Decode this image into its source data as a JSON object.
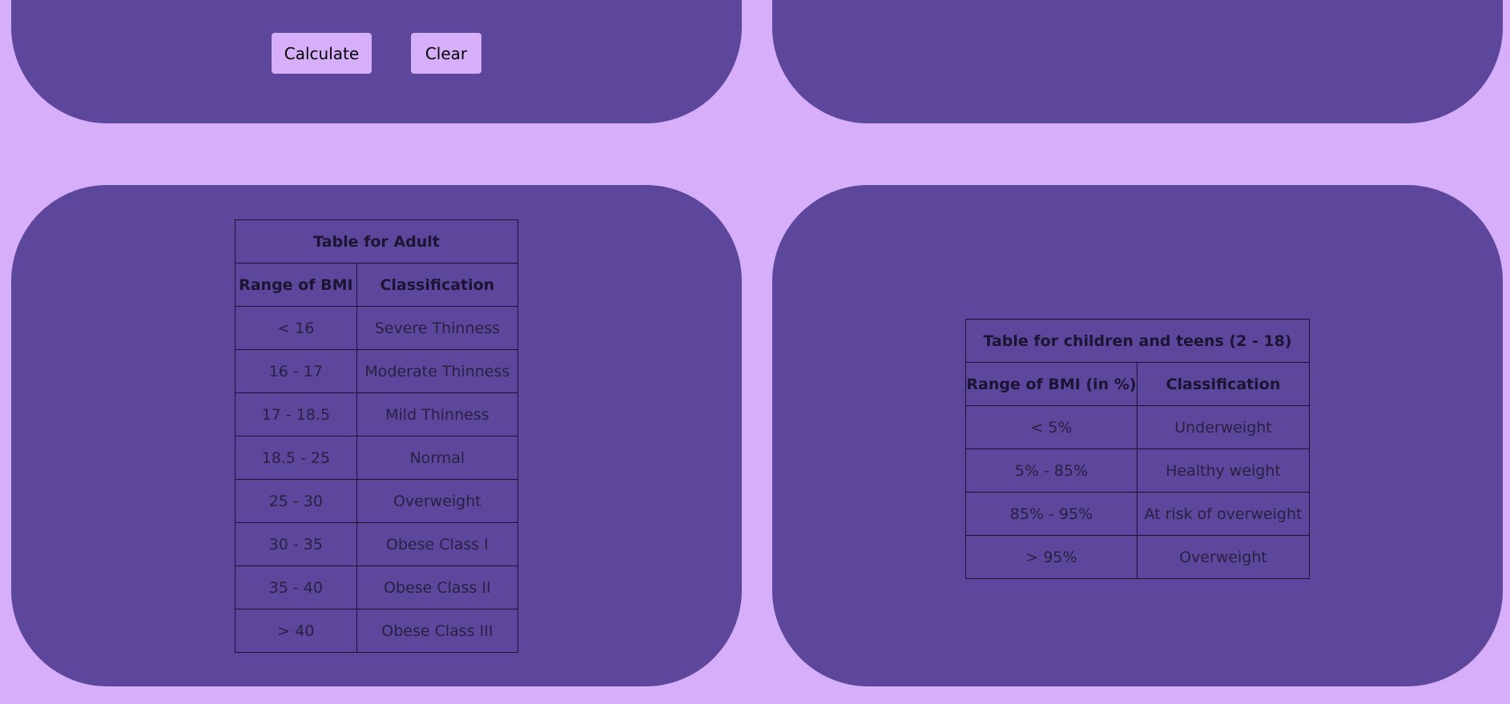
{
  "buttons": {
    "calculate": "Calculate",
    "clear": "Clear"
  },
  "adult_table": {
    "title": "Table for Adult",
    "headers": [
      "Range of BMI",
      "Classification"
    ],
    "rows": [
      [
        "< 16",
        "Severe Thinness"
      ],
      [
        "16 - 17",
        "Moderate Thinness"
      ],
      [
        "17 - 18.5",
        "Mild Thinness"
      ],
      [
        "18.5 - 25",
        "Normal"
      ],
      [
        "25 - 30",
        "Overweight"
      ],
      [
        "30 - 35",
        "Obese Class I"
      ],
      [
        "35 - 40",
        "Obese Class II"
      ],
      [
        "> 40",
        "Obese Class III"
      ]
    ]
  },
  "child_table": {
    "title": "Table for children and teens (2 - 18)",
    "headers": [
      "Range of BMI (in %)",
      "Classification"
    ],
    "rows": [
      [
        "< 5%",
        "Underweight"
      ],
      [
        "5% - 85%",
        "Healthy weight"
      ],
      [
        "85% - 95%",
        "At risk of overweight"
      ],
      [
        "> 95%",
        "Overweight"
      ]
    ]
  },
  "colors": {
    "page_background": "#d6aefa",
    "panel": "#5c479c",
    "button": "#d6aefa"
  }
}
